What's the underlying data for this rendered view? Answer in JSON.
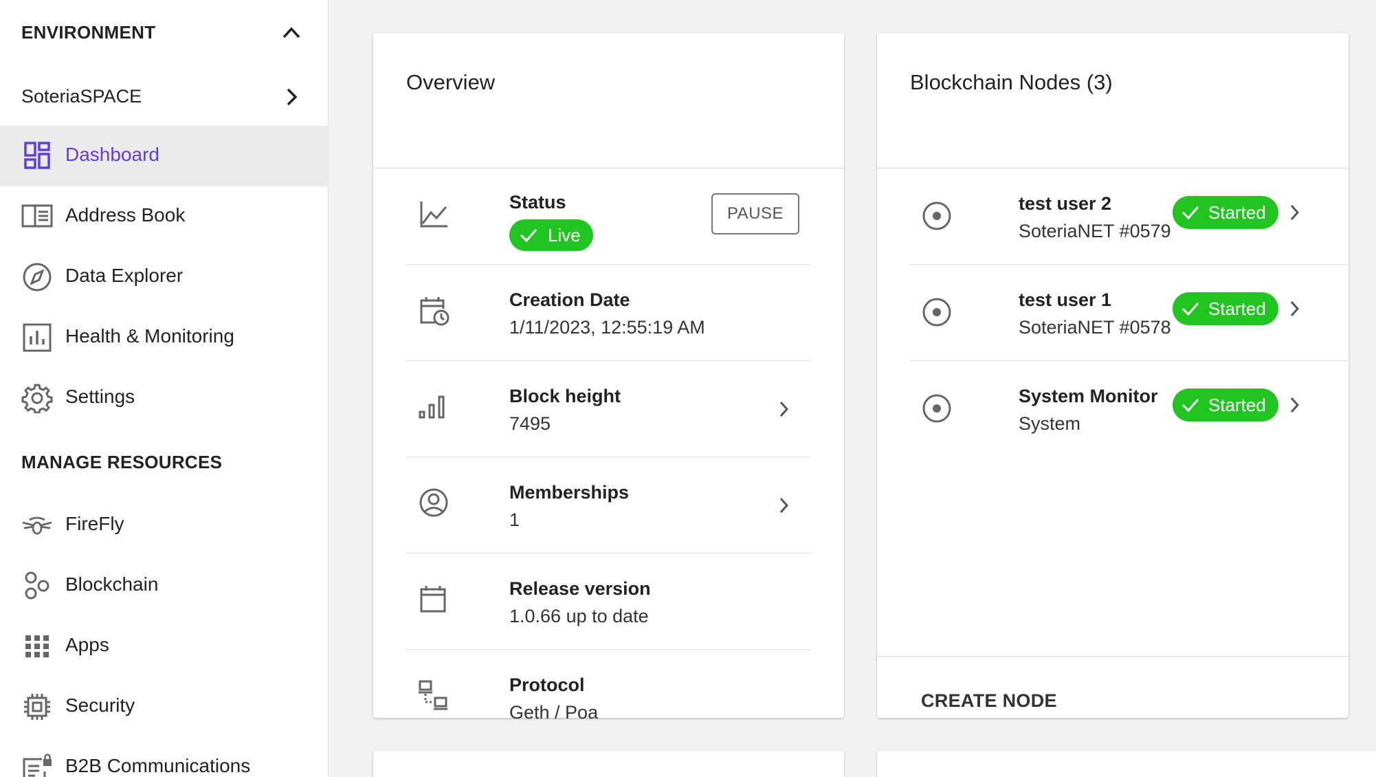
{
  "sidebar": {
    "environment_header": "ENVIRONMENT",
    "environment_name": "SoteriaSPACE",
    "env_items": [
      {
        "label": "Dashboard",
        "icon": "dashboard-icon",
        "active": true
      },
      {
        "label": "Address Book",
        "icon": "address-book-icon"
      },
      {
        "label": "Data Explorer",
        "icon": "compass-icon"
      },
      {
        "label": "Health & Monitoring",
        "icon": "bar-chart-icon"
      },
      {
        "label": "Settings",
        "icon": "gear-icon"
      }
    ],
    "manage_header": "MANAGE RESOURCES",
    "manage_items": [
      {
        "label": "FireFly",
        "icon": "firefly-icon"
      },
      {
        "label": "Blockchain",
        "icon": "hexagons-icon"
      },
      {
        "label": "Apps",
        "icon": "apps-grid-icon"
      },
      {
        "label": "Security",
        "icon": "chip-icon"
      },
      {
        "label": "B2B Communications",
        "icon": "locked-document-icon"
      }
    ]
  },
  "overview": {
    "title": "Overview",
    "status_label": "Status",
    "status_value": "Live",
    "pause_label": "PAUSE",
    "rows": [
      {
        "label": "Creation Date",
        "value": "1/11/2023, 12:55:19 AM",
        "icon": "calendar-clock-icon"
      },
      {
        "label": "Block height",
        "value": "7495",
        "icon": "signal-bars-icon"
      },
      {
        "label": "Memberships",
        "value": "1",
        "icon": "user-circle-icon"
      },
      {
        "label": "Release version",
        "value": "1.0.66 up to date",
        "icon": "calendar-icon"
      },
      {
        "label": "Protocol",
        "value": "Geth / Poa",
        "icon": "network-icon"
      }
    ]
  },
  "nodes": {
    "title": "Blockchain Nodes (3)",
    "items": [
      {
        "name": "test user 2",
        "sub": "SoteriaNET #0579",
        "status": "Started"
      },
      {
        "name": "test user 1",
        "sub": "SoteriaNET #0578",
        "status": "Started"
      },
      {
        "name": "System Monitor",
        "sub": "System",
        "status": "Started"
      }
    ],
    "create_label": "CREATE NODE"
  },
  "colors": {
    "accent": "#5b3fd6",
    "success": "#22c422",
    "icon_gray": "#666666"
  }
}
